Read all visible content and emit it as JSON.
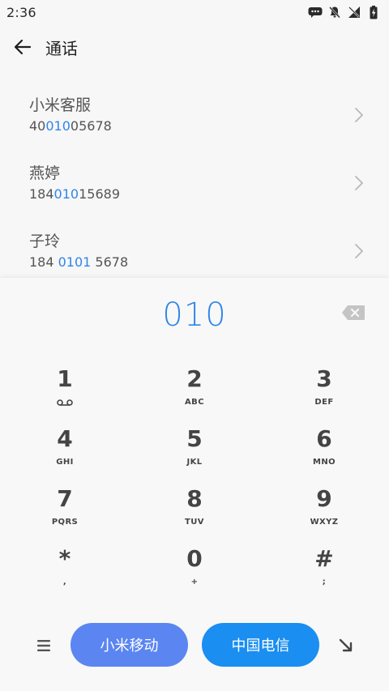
{
  "status_bar": {
    "time": "2:36",
    "icons": [
      "chat-bubble-icon",
      "bell-off-icon",
      "no-signal-icon",
      "battery-charging-icon"
    ]
  },
  "app_bar": {
    "title": "通话",
    "back_icon": "arrow-left-icon"
  },
  "contacts": [
    {
      "name": "小米客服",
      "number_parts": [
        "40",
        "010",
        "05678"
      ]
    },
    {
      "name": "燕婷",
      "number_parts": [
        "184",
        "010",
        "15689"
      ]
    },
    {
      "name": "子玲",
      "number_parts": [
        "184 ",
        "0101",
        " 5678"
      ]
    }
  ],
  "dialpad": {
    "entered_number": "010",
    "keys": [
      {
        "digit": "1",
        "letters": "",
        "sub_icon": "voicemail-icon"
      },
      {
        "digit": "2",
        "letters": "ABC"
      },
      {
        "digit": "3",
        "letters": "DEF"
      },
      {
        "digit": "4",
        "letters": "GHI"
      },
      {
        "digit": "5",
        "letters": "JKL"
      },
      {
        "digit": "6",
        "letters": "MNO"
      },
      {
        "digit": "7",
        "letters": "PQRS"
      },
      {
        "digit": "8",
        "letters": "TUV"
      },
      {
        "digit": "9",
        "letters": "WXYZ"
      },
      {
        "digit": "*",
        "letters": ","
      },
      {
        "digit": "0",
        "letters": "+"
      },
      {
        "digit": "#",
        "letters": ";"
      }
    ]
  },
  "bottom_bar": {
    "sim1_label": "小米移动",
    "sim2_label": "中国电信"
  },
  "colors": {
    "accent": "#2f86e8",
    "sim1": "#5b86f1",
    "sim2": "#1a8ef1",
    "background": "#f7f7f7"
  }
}
